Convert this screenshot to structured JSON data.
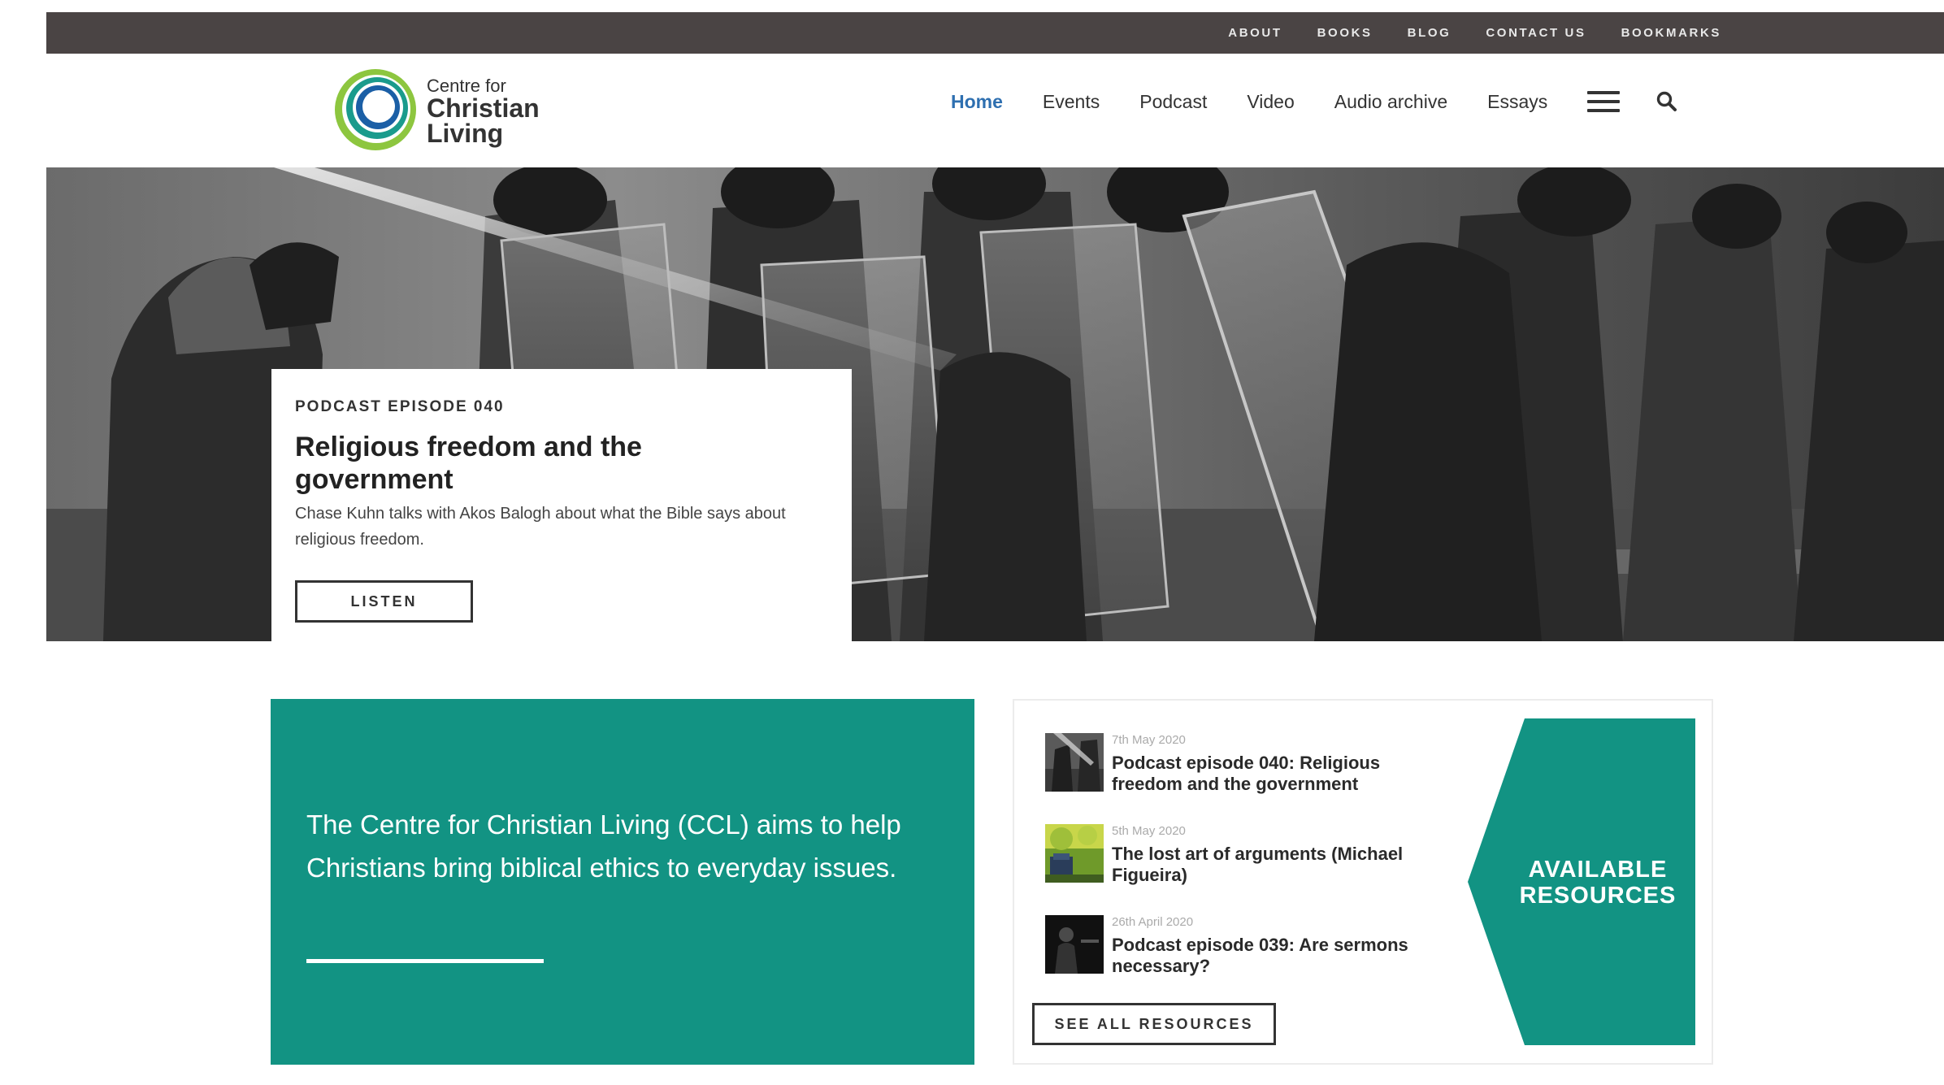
{
  "topbar": {
    "links": [
      "ABOUT",
      "BOOKS",
      "BLOG",
      "CONTACT US",
      "BOOKMARKS"
    ]
  },
  "logo": {
    "line1": "Centre for",
    "line2": "Christian",
    "line3": "Living"
  },
  "nav": {
    "items": [
      "Home",
      "Events",
      "Podcast",
      "Video",
      "Audio archive",
      "Essays"
    ],
    "active": "Home"
  },
  "icons": {
    "menu": "hamburger-menu-icon",
    "search": "search-icon"
  },
  "hero": {
    "eyebrow": "PODCAST EPISODE 040",
    "title": "Religious freedom and the government",
    "description": "Chase Kuhn talks with Akos Balogh about what the Bible says about religious freedom.",
    "button": "LISTEN"
  },
  "mission": {
    "text": "The Centre for Christian Living (CCL) aims to help Christians bring biblical ethics to everyday issues."
  },
  "resources": {
    "items": [
      {
        "date": "7th May 2020",
        "title": "Podcast episode 040: Religious freedom and the government"
      },
      {
        "date": "5th May 2020",
        "title": "The lost art of arguments (Michael Figueira)"
      },
      {
        "date": "26th April 2020",
        "title": "Podcast episode 039: Are sermons necessary?"
      }
    ],
    "button": "SEE ALL RESOURCES",
    "panel_label": "AVAILABLE RESOURCES"
  },
  "colors": {
    "topbar": "#4a4444",
    "teal": "#129383",
    "nav_active": "#2e6fb0",
    "logo_green": "#8dc63f",
    "logo_teal": "#1a9b8c",
    "logo_blue": "#1b5fa6"
  }
}
